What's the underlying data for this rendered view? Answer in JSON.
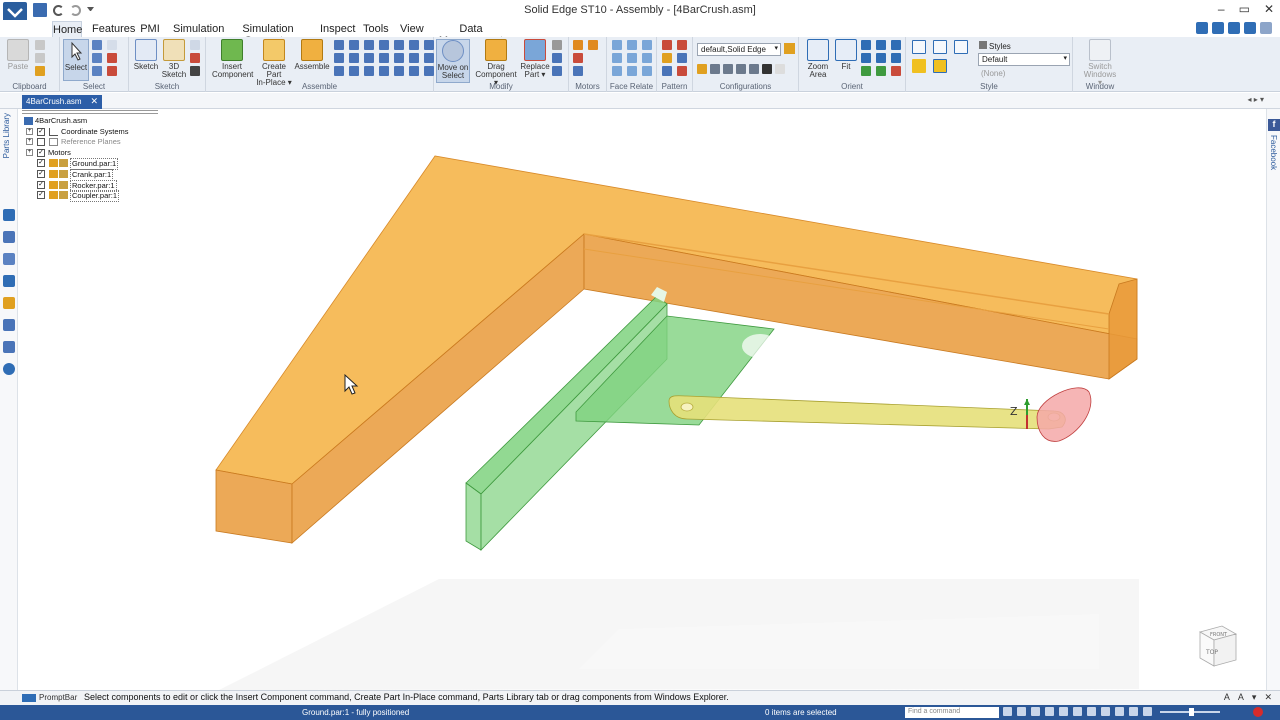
{
  "window": {
    "title": "Solid Edge ST10 - Assembly - [4BarCrush.asm]",
    "controls": [
      "–",
      "▭",
      "✕"
    ]
  },
  "ribbon": {
    "tabs": [
      "Home",
      "Features",
      "PMI",
      "Simulation",
      "Simulation Geometry",
      "Inspect",
      "Tools",
      "View",
      "Data Management"
    ],
    "active_tab": "Home",
    "groups": {
      "clipboard": {
        "label": "Clipboard",
        "paste": "Paste"
      },
      "select": {
        "label": "Select",
        "select": "Select"
      },
      "sketch": {
        "label": "Sketch",
        "sketch": "Sketch",
        "sketch3d_line1": "3D",
        "sketch3d_line2": "Sketch"
      },
      "assemble": {
        "label": "Assemble",
        "insert_line1": "Insert",
        "insert_line2": "Component",
        "create_line1": "Create Part",
        "create_line2": "In-Place ▾",
        "assemble": "Assemble"
      },
      "modify": {
        "label": "Modify",
        "move_line1": "Move on",
        "move_line2": "Select",
        "drag_line1": "Drag",
        "drag_line2": "Component ▾",
        "replace_line1": "Replace",
        "replace_line2": "Part ▾"
      },
      "motors": {
        "label": "Motors"
      },
      "face_relate": {
        "label": "Face Relate"
      },
      "pattern": {
        "label": "Pattern"
      },
      "configurations": {
        "label": "Configurations",
        "value": "default,Solid Edge"
      },
      "orient": {
        "label": "Orient",
        "zoom_line1": "Zoom",
        "zoom_line2": "Area",
        "fit": "Fit"
      },
      "style": {
        "label": "Style",
        "styles": "Styles",
        "value": "Default",
        "secondary": "(None)"
      },
      "window": {
        "label": "Window",
        "switch_line1": "Switch",
        "switch_line2": "Windows ▾"
      }
    }
  },
  "document": {
    "tab_label": "4BarCrush.asm",
    "close": "✕"
  },
  "left_strip": {
    "label": "Parts Library"
  },
  "right_strip": {
    "label": "Facebook",
    "badge": "f"
  },
  "pathfinder": {
    "root": "4BarCrush.asm",
    "items": [
      {
        "label": "Coordinate Systems",
        "expander": "+",
        "checked": true
      },
      {
        "label": "Reference Planes",
        "expander": "+",
        "checked": false
      },
      {
        "label": "Motors",
        "expander": "+",
        "checked": true
      },
      {
        "label": "Ground.par:1",
        "checked": true
      },
      {
        "label": "Crank.par:1",
        "checked": true
      },
      {
        "label": "Rocker.par:1",
        "checked": true
      },
      {
        "label": "Coupler.par:1",
        "checked": true
      }
    ]
  },
  "viewport": {
    "triad_label": "Z",
    "viewcube_top": "FRONT",
    "viewcube_face": "TOP",
    "colors": {
      "ground": "#f5b54a",
      "ground_side": "#e99a3a",
      "rocker": "#7fd27f",
      "coupler": "#e6e07a",
      "crank": "#f4a8a8"
    }
  },
  "promptbar": {
    "label": "PromptBar",
    "text": "Select components to edit or click the Insert Component command, Create Part In-Place command, Parts Library tab or drag components from Windows Explorer."
  },
  "statusbar": {
    "left": "Ground.par:1 - fully positioned",
    "middle": "0 items are selected",
    "find_placeholder": "Find a command"
  }
}
